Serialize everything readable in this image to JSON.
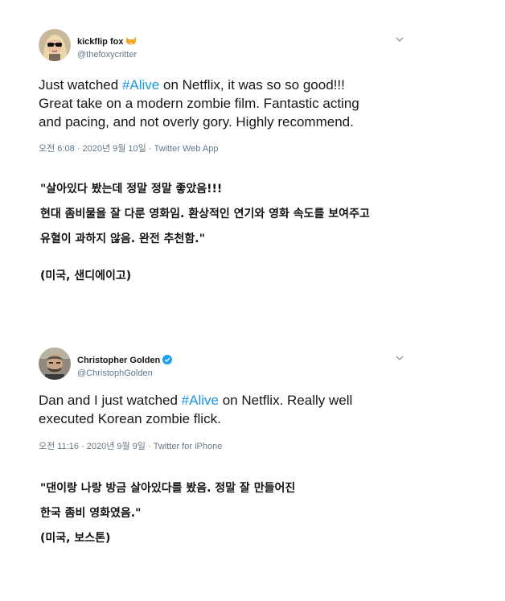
{
  "tweets": [
    {
      "display_name": "kickflip fox",
      "name_emoji": "fox-emoji",
      "handle": "@thefoxycritter",
      "text_lines": [
        {
          "pre": "Just watched ",
          "hashtag": "#Alive",
          "post": " on Netflix, it was so so good!!!"
        },
        {
          "pre": "Great take on a modern zombie film. Fantastic acting",
          "hashtag": "",
          "post": ""
        },
        {
          "pre": "and pacing, and not overly gory. Highly recommend.",
          "hashtag": "",
          "post": ""
        }
      ],
      "meta": "오전 6:08 · 2020년 9월 10일 · Twitter Web App",
      "translation_lines": [
        "\"살아있다 봤는데 정말 정말 좋았음!!!",
        "현대 좀비물을 잘 다룬 영화임. 환상적인 연기와 영화 속도를 보여주고",
        "유혈이 과하지 않음. 완전 추천함.\""
      ],
      "location": "(미국, 샌디에이고)"
    },
    {
      "display_name": "Christopher Golden",
      "name_badge": "verified-icon",
      "handle": "@ChristophGolden",
      "text_lines": [
        {
          "pre": "Dan and I just watched ",
          "hashtag": "#Alive",
          "post": " on Netflix. Really well"
        },
        {
          "pre": "executed Korean zombie flick.",
          "hashtag": "",
          "post": ""
        }
      ],
      "meta": "오전 11:16 · 2020년 9월 9일 · Twitter for iPhone",
      "translation_lines": [
        "\"댄이랑 나랑 방금 살아있다를 봤음. 정말 잘 만들어진",
        "한국 좀비 영화였음.\""
      ],
      "location": "(미국, 보스톤)"
    }
  ],
  "colors": {
    "hashtag": "#1b95e0",
    "verified": "#1da1f2",
    "secondary": "#657786",
    "fox": "#f5a623"
  }
}
